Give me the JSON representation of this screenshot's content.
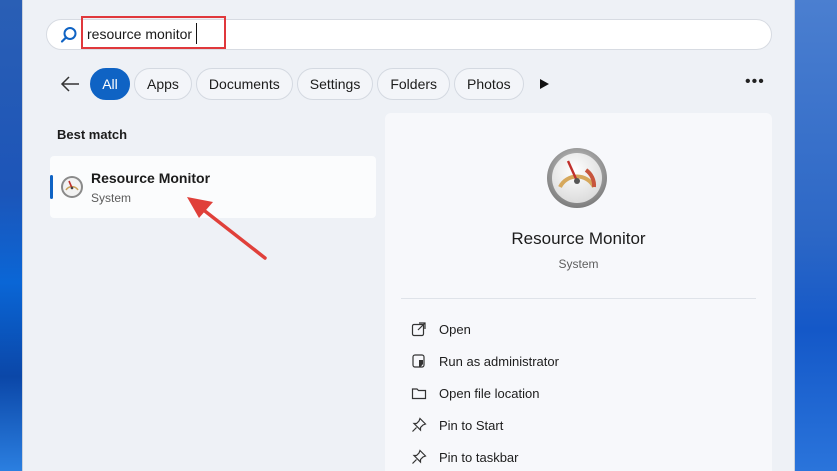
{
  "search": {
    "value": "resource monitor"
  },
  "filters": {
    "items": [
      "All",
      "Apps",
      "Documents",
      "Settings",
      "Folders",
      "Photos"
    ]
  },
  "results": {
    "section_title": "Best match",
    "item": {
      "title": "Resource Monitor",
      "subtitle": "System"
    }
  },
  "detail": {
    "title": "Resource Monitor",
    "subtitle": "System",
    "actions": [
      {
        "label": "Open",
        "icon": "open-external-icon"
      },
      {
        "label": "Run as administrator",
        "icon": "shield-icon"
      },
      {
        "label": "Open file location",
        "icon": "folder-icon"
      },
      {
        "label": "Pin to Start",
        "icon": "pin-icon"
      },
      {
        "label": "Pin to taskbar",
        "icon": "pin-icon"
      }
    ]
  },
  "colors": {
    "accent": "#0f63c4",
    "highlight": "#e0383c",
    "panel": "#eef1f6"
  }
}
